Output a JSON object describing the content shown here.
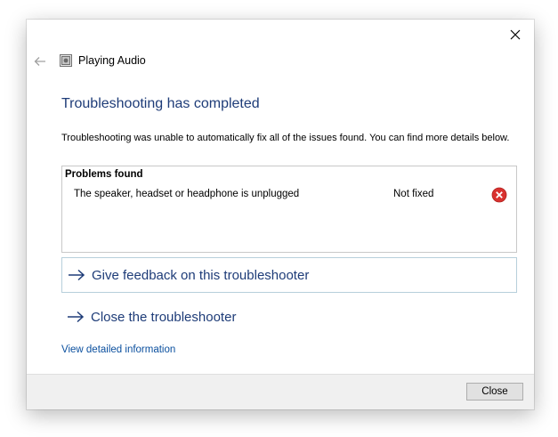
{
  "window": {
    "close_icon": "close-icon",
    "back_icon": "back-arrow-icon"
  },
  "titlebar": {
    "icon": "speaker-icon",
    "title": "Playing Audio"
  },
  "main": {
    "heading": "Troubleshooting has completed",
    "description": "Troubleshooting was unable to automatically fix all of the issues found. You can find more details below.",
    "problems": {
      "header": "Problems found",
      "items": [
        {
          "text": "The speaker, headset or headphone is unplugged",
          "status": "Not fixed",
          "status_icon": "error-icon"
        }
      ]
    },
    "commands": [
      {
        "label": "Give feedback on this troubleshooter",
        "icon": "arrow-right-icon"
      },
      {
        "label": "Close the troubleshooter",
        "icon": "arrow-right-icon"
      }
    ],
    "detail_link": "View detailed information"
  },
  "footer": {
    "close_button": "Close"
  },
  "colors": {
    "heading": "#1e3c78",
    "link": "#0a4f9e",
    "error": "#d9312f",
    "footer_bg": "#f0f0f0"
  }
}
